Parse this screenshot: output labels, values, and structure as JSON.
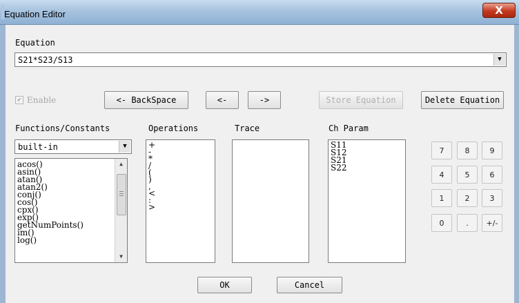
{
  "window": {
    "title": "Equation Editor",
    "close_glyph": "X"
  },
  "equation": {
    "label": "Equation",
    "value": "S21*S23/S13",
    "dropdown_glyph": "▼"
  },
  "toolbar": {
    "enable_label": "Enable",
    "enable_checked": true,
    "backspace_label": "<- BackSpace",
    "left_label": "<-",
    "right_label": "->",
    "store_label": "Store Equation",
    "delete_label": "Delete Equation"
  },
  "functions": {
    "label": "Functions/Constants",
    "selected": "built-in",
    "items": [
      "acos()",
      "asin()",
      "atan()",
      "atan2()",
      "conj()",
      "cos()",
      "cpx()",
      "exp()",
      "getNumPoints()",
      "im()",
      "log()"
    ]
  },
  "operations": {
    "label": "Operations",
    "items": [
      "+",
      "-",
      "*",
      "/",
      "(",
      ")",
      ",",
      "<",
      ":",
      ">"
    ]
  },
  "trace": {
    "label": "Trace",
    "items": []
  },
  "ch_param": {
    "label": "Ch Param",
    "items": [
      "S11",
      "S12",
      "S21",
      "S22"
    ]
  },
  "keypad": {
    "keys": [
      "7",
      "8",
      "9",
      "4",
      "5",
      "6",
      "1",
      "2",
      "3",
      "0",
      ".",
      "+/-"
    ]
  },
  "footer": {
    "ok_label": "OK",
    "cancel_label": "Cancel"
  }
}
